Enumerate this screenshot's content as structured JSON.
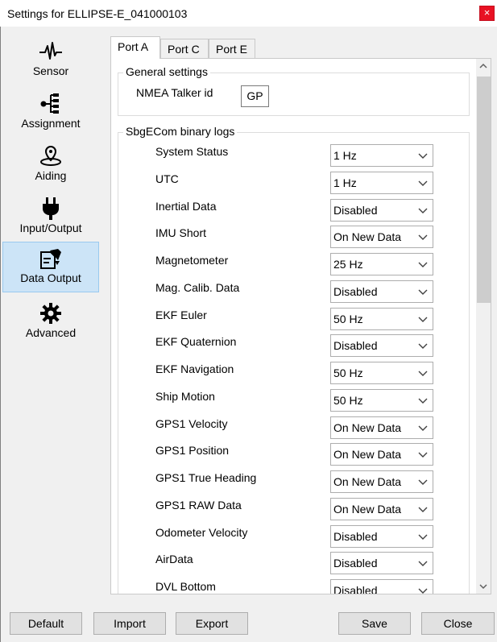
{
  "window": {
    "title": "Settings for ELLIPSE-E_041000103",
    "close_glyph": "×"
  },
  "sidebar": {
    "items": [
      {
        "label": "Sensor",
        "icon": "waveform-icon"
      },
      {
        "label": "Assignment",
        "icon": "hierarchy-icon"
      },
      {
        "label": "Aiding",
        "icon": "satellite-icon"
      },
      {
        "label": "Input/Output",
        "icon": "plug-icon"
      },
      {
        "label": "Data Output",
        "icon": "data-output-icon",
        "active": true
      },
      {
        "label": "Advanced",
        "icon": "gear-icon"
      }
    ]
  },
  "tabs": [
    {
      "label": "Port A",
      "active": true
    },
    {
      "label": "Port C"
    },
    {
      "label": "Port E"
    }
  ],
  "general": {
    "title": "General settings",
    "talker_label": "NMEA Talker id",
    "talker_value": "GP"
  },
  "binary_logs": {
    "title": "SbgECom binary logs",
    "rows": [
      {
        "label": "System Status",
        "value": "1 Hz"
      },
      {
        "label": "UTC",
        "value": "1 Hz"
      },
      {
        "label": "Inertial Data",
        "value": "Disabled"
      },
      {
        "label": "IMU Short",
        "value": "On New Data"
      },
      {
        "label": "Magnetometer",
        "value": "25 Hz"
      },
      {
        "label": "Mag. Calib. Data",
        "value": "Disabled"
      },
      {
        "label": "EKF Euler",
        "value": "50 Hz"
      },
      {
        "label": "EKF Quaternion",
        "value": "Disabled"
      },
      {
        "label": "EKF Navigation",
        "value": "50 Hz"
      },
      {
        "label": "Ship Motion",
        "value": "50 Hz"
      },
      {
        "label": "GPS1 Velocity",
        "value": "On New Data"
      },
      {
        "label": "GPS1 Position",
        "value": "On New Data"
      },
      {
        "label": "GPS1 True Heading",
        "value": "On New Data"
      },
      {
        "label": "GPS1 RAW Data",
        "value": "On New Data"
      },
      {
        "label": "Odometer Velocity",
        "value": "Disabled"
      },
      {
        "label": "AirData",
        "value": "Disabled"
      },
      {
        "label": "DVL Bottom",
        "value": "Disabled"
      }
    ]
  },
  "buttons": {
    "default": "Default",
    "import": "Import",
    "export": "Export",
    "save": "Save",
    "close": "Close"
  },
  "colors": {
    "active_nav_bg": "#cce4f7",
    "close_button": "#e81123"
  }
}
